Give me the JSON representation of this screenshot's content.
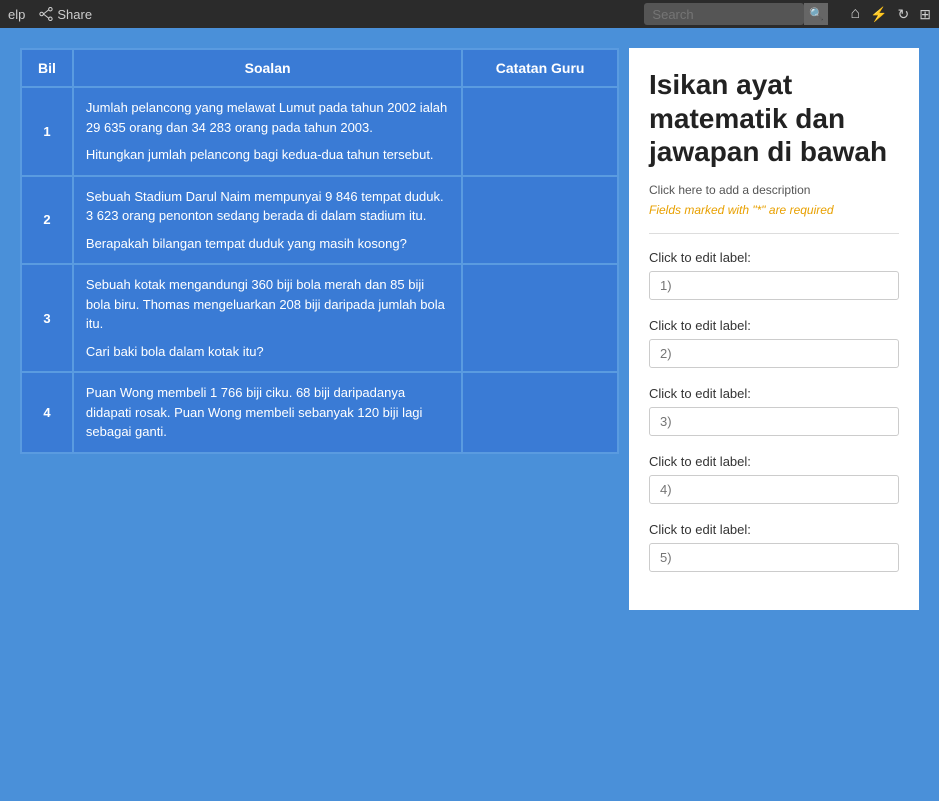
{
  "topbar": {
    "help_label": "elp",
    "share_label": "Share",
    "search_placeholder": "Search",
    "icons": [
      "home",
      "flash",
      "refresh",
      "grid"
    ]
  },
  "table": {
    "col_bil": "Bil",
    "col_soalan": "Soalan",
    "col_catatan": "Catatan Guru",
    "rows": [
      {
        "num": "1",
        "question_lines": [
          "Jumlah pelancong yang melawat Lumut pada tahun 2002 ialah 29 635 orang dan 34 283 orang pada tahun 2003.",
          "Hitungkan jumlah pelancong bagi kedua-dua tahun tersebut."
        ],
        "catatan": ""
      },
      {
        "num": "2",
        "question_lines": [
          "Sebuah Stadium Darul Naim mempunyai 9 846 tempat duduk. 3 623 orang penonton sedang berada di dalam stadium itu.",
          "Berapakah bilangan tempat duduk yang masih kosong?"
        ],
        "catatan": ""
      },
      {
        "num": "3",
        "question_lines": [
          "Sebuah kotak mengandungi 360 biji bola merah dan 85 biji bola biru. Thomas mengeluarkan 208 biji daripada jumlah bola itu.",
          "Cari baki bola dalam kotak itu?"
        ],
        "catatan": ""
      },
      {
        "num": "4",
        "question_lines": [
          "Puan Wong membeli 1 766 biji ciku. 68 biji daripadanya didapati rosak.          Puan Wong membeli sebanyak 120 biji lagi sebagai ganti."
        ],
        "catatan": ""
      }
    ]
  },
  "panel": {
    "title": "Isikan ayat matematik dan jawapan di bawah",
    "description": "Click here to add a description",
    "required_text": "Fields marked with \"*\" are required",
    "fields": [
      {
        "label": "Click to edit label:",
        "placeholder": "1)"
      },
      {
        "label": "Click to edit label:",
        "placeholder": "2)"
      },
      {
        "label": "Click to edit label:",
        "placeholder": "3)"
      },
      {
        "label": "Click to edit label:",
        "placeholder": "4)"
      },
      {
        "label": "Click to edit label:",
        "placeholder": "5)"
      }
    ]
  }
}
